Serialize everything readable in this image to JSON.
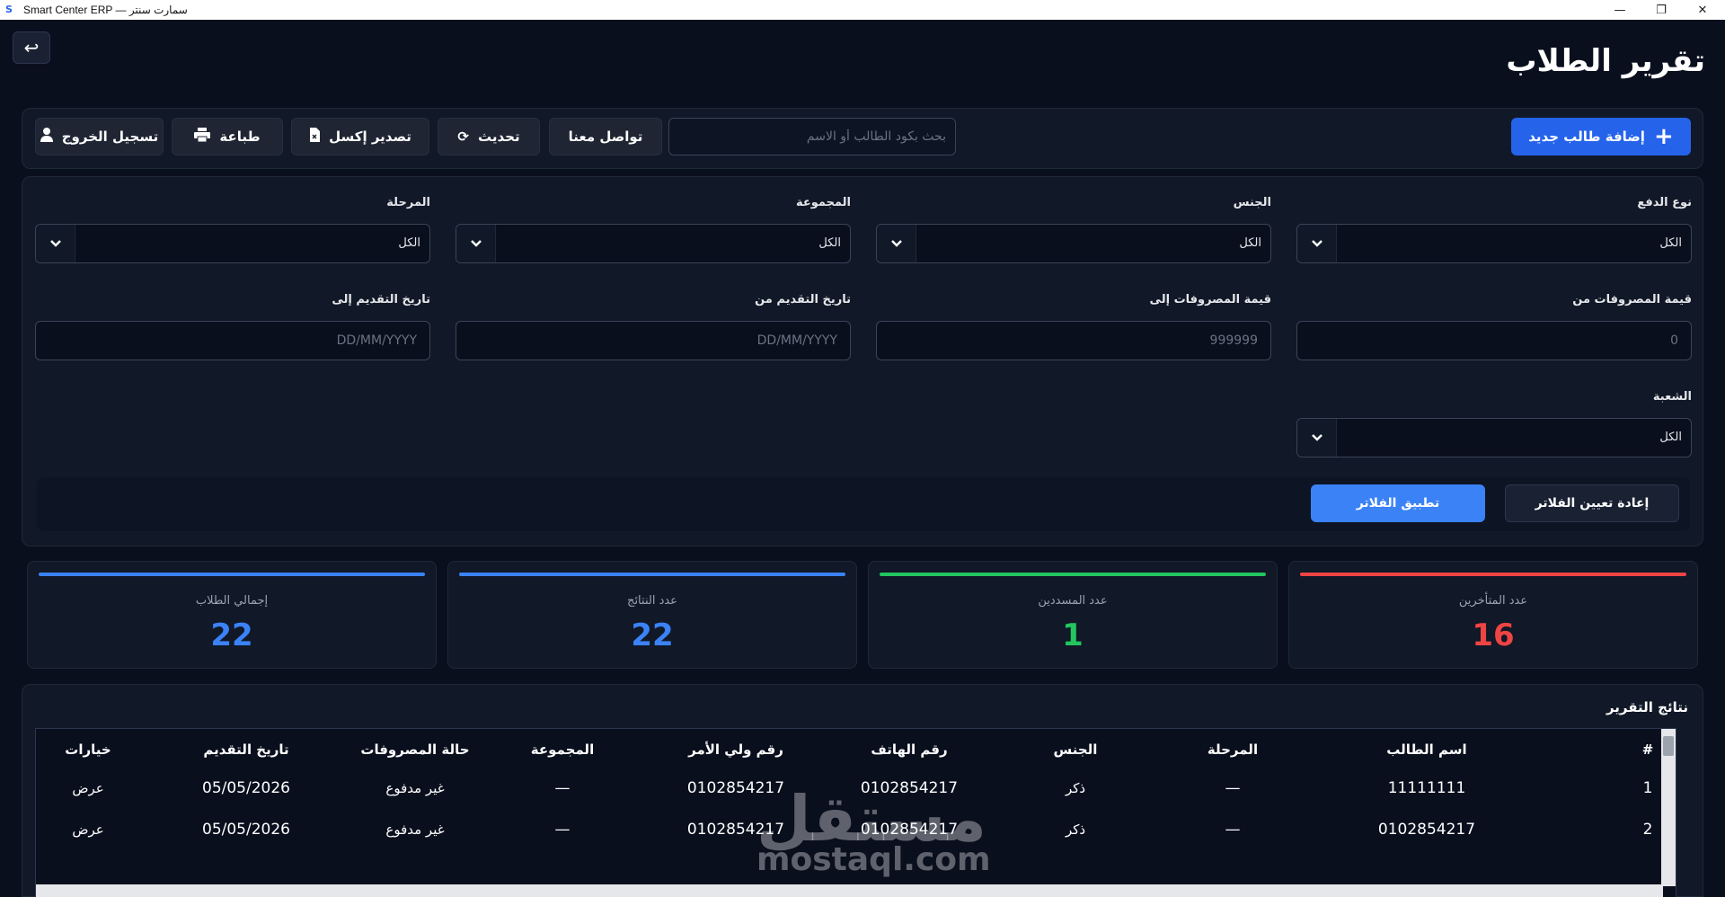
{
  "window": {
    "title": "Smart Center ERP — سمارت سنتر",
    "logo": "S"
  },
  "page": {
    "title": "تقرير الطلاب"
  },
  "toolbar": {
    "add_student": "إضافة طالب جديد",
    "search_placeholder": "بحث بكود الطالب أو الاسم",
    "contact": "تواصل معنا",
    "refresh": "تحديث",
    "export_excel": "تصدير إكسل",
    "print": "طباعة",
    "logout": "تسجيل الخروج"
  },
  "filters": {
    "payment_type": {
      "label": "نوع الدفع",
      "value": "الكل"
    },
    "gender": {
      "label": "الجنس",
      "value": "الكل"
    },
    "group": {
      "label": "المجموعة",
      "value": "الكل"
    },
    "stage": {
      "label": "المرحلة",
      "value": "الكل"
    },
    "expenses_from": {
      "label": "قيمة المصروفات من",
      "placeholder": "0"
    },
    "expenses_to": {
      "label": "قيمة المصروفات إلى",
      "placeholder": "999999"
    },
    "date_from": {
      "label": "تاريخ التقديم من",
      "placeholder": "DD/MM/YYYY"
    },
    "date_to": {
      "label": "تاريخ التقديم إلى",
      "placeholder": "DD/MM/YYYY"
    },
    "division": {
      "label": "الشعبة",
      "value": "الكل"
    },
    "reset_label": "إعادة تعيين الفلاتر",
    "apply_label": "تطبيق الفلاتر"
  },
  "stats": [
    {
      "label": "عدد المتأخرين",
      "value": "16",
      "color": "#ef4444"
    },
    {
      "label": "عدد المسددين",
      "value": "1",
      "color": "#22c55e"
    },
    {
      "label": "عدد النتائج",
      "value": "22",
      "color": "#3b82f6"
    },
    {
      "label": "إجمالي الطلاب",
      "value": "22",
      "color": "#3b82f6"
    }
  ],
  "results": {
    "title": "نتائج التقرير",
    "columns": [
      "#",
      "اسم الطالب",
      "المرحلة",
      "الجنس",
      "رقم الهاتف",
      "رقم ولي الأمر",
      "المجموعة",
      "حالة المصروفات",
      "تاريخ التقديم",
      "خيارات"
    ],
    "rows": [
      [
        "1",
        "11111111",
        "—",
        "ذكر",
        "0102854217",
        "0102854217",
        "—",
        "غير مدفوع",
        "05/05/2026",
        "عرض"
      ],
      [
        "2",
        "0102854217",
        "—",
        "ذكر",
        "0102854217",
        "0102854217",
        "—",
        "غير مدفوع",
        "05/05/2026",
        "عرض"
      ]
    ]
  },
  "watermark": {
    "arabic": "مستقل",
    "latin": "mostaql.com"
  }
}
